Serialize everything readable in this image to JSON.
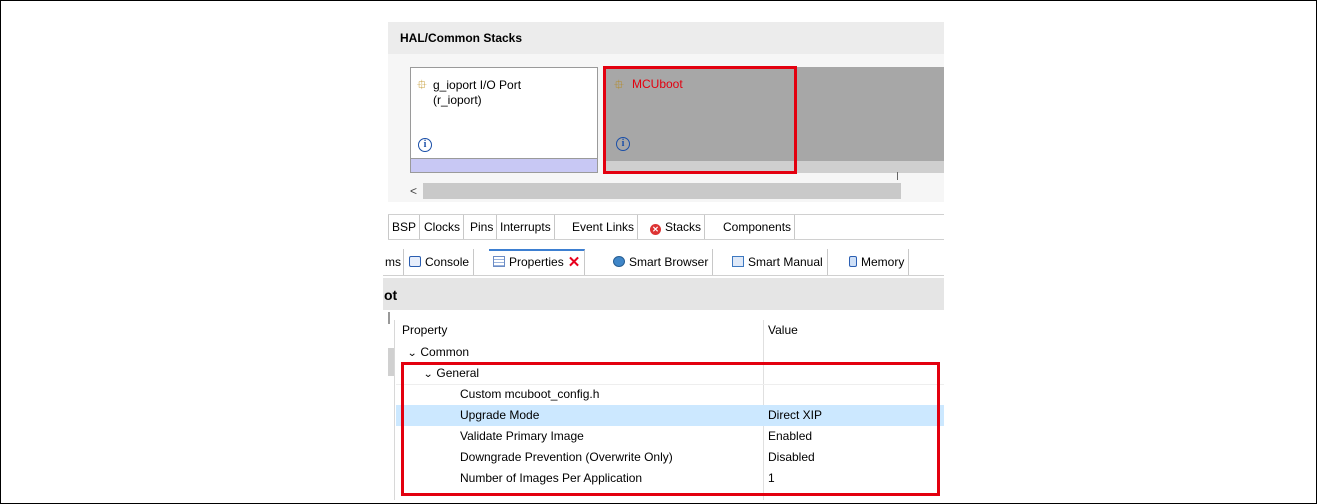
{
  "stacks": {
    "title": "HAL/Common Stacks",
    "cards": [
      {
        "title_line1": "g_ioport I/O Port",
        "title_line2": "(r_ioport)",
        "icon": "module-icon"
      },
      {
        "title_line1": "MCUboot",
        "title_line2": "",
        "icon": "module-error-icon",
        "title_color": "#e3000f"
      }
    ],
    "scroll_left": "<"
  },
  "editor_tabs": [
    "BSP",
    "Clocks",
    "Pins",
    "Interrupts",
    "Event Links",
    "Stacks",
    "Components"
  ],
  "view_tabs": {
    "partial": "ms",
    "console": "Console",
    "properties": "Properties",
    "smart_browser": "Smart Browser",
    "smart_manual": "Smart Manual",
    "memory": "Memory",
    "close": "✕"
  },
  "properties": {
    "header": "ot",
    "col_property": "Property",
    "col_value": "Value",
    "common": "Common",
    "general": "General",
    "rows": [
      {
        "property": "Custom mcuboot_config.h",
        "value": ""
      },
      {
        "property": "Upgrade Mode",
        "value": "Direct XIP",
        "selected": true
      },
      {
        "property": "Validate Primary Image",
        "value": "Enabled"
      },
      {
        "property": "Downgrade Prevention (Overwrite Only)",
        "value": "Disabled"
      },
      {
        "property": "Number of Images Per Application",
        "value": "1"
      }
    ]
  },
  "colors": {
    "highlight": "#e3000f",
    "selection": "#cce8ff",
    "accent": "#3d7fd1"
  }
}
